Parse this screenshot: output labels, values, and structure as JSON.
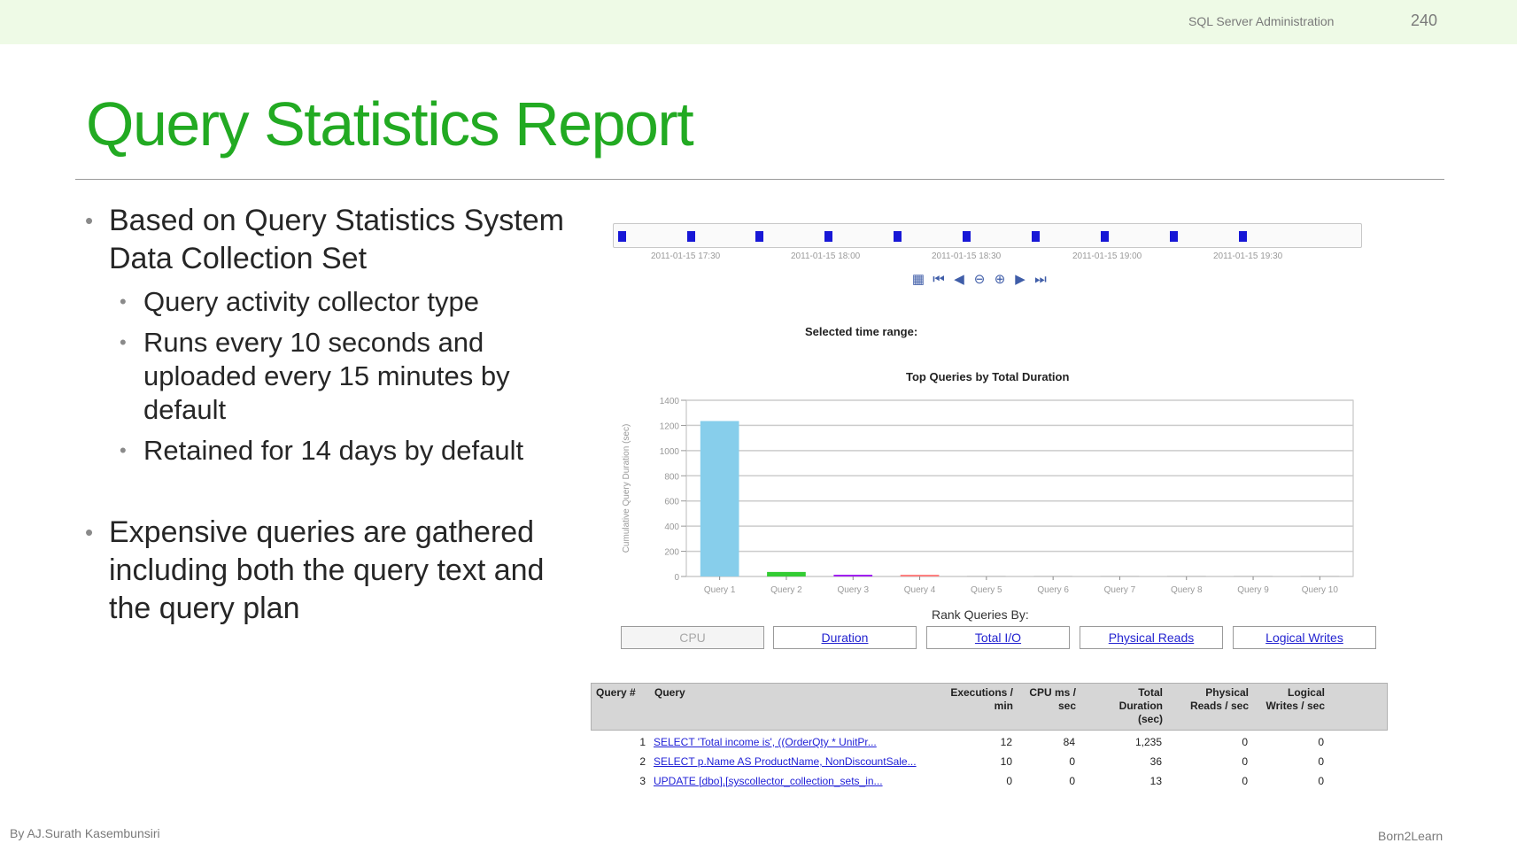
{
  "header": {
    "course": "SQL Server  Administration",
    "page_number": "240"
  },
  "slide": {
    "title": "Query Statistics Report",
    "bullets": [
      {
        "text": "Based on Query Statistics System Data Collection Set",
        "sub": [
          "Query activity collector type",
          "Runs every 10 seconds and uploaded every 15 minutes by default",
          "Retained for 14 days by default"
        ]
      },
      {
        "text": "Expensive queries are gathered including both the query text and the query plan"
      }
    ]
  },
  "report": {
    "timeline_labels": [
      "2011-01-15 17:30",
      "2011-01-15 18:00",
      "2011-01-15 18:30",
      "2011-01-15 19:00",
      "2011-01-15 19:30"
    ],
    "toolbar_icons": [
      "calendar-icon",
      "first-icon",
      "previous-icon",
      "zoom-out-icon",
      "zoom-in-icon",
      "next-icon",
      "last-icon"
    ],
    "selected_time_range_label": "Selected time range:",
    "rank_label": "Rank Queries By:",
    "rank_buttons": [
      "CPU",
      "Duration",
      "Total I/O",
      "Physical Reads",
      "Logical Writes"
    ],
    "table": {
      "headers": [
        "Query #",
        "Query",
        "Executions / min",
        "CPU ms / sec",
        "Total Duration (sec)",
        "Physical Reads / sec",
        "Logical Writes / sec"
      ],
      "rows": [
        {
          "num": "1",
          "query": "SELECT 'Total income is', ((OrderQty * UnitPr...",
          "exec": "12",
          "cpu": "84",
          "duration": "1,235",
          "reads": "0",
          "writes": "0"
        },
        {
          "num": "2",
          "query": "SELECT p.Name AS ProductName, NonDiscountSale...",
          "exec": "10",
          "cpu": "0",
          "duration": "36",
          "reads": "0",
          "writes": "0"
        },
        {
          "num": "3",
          "query": "UPDATE [dbo].[syscollector_collection_sets_in...",
          "exec": "0",
          "cpu": "0",
          "duration": "13",
          "reads": "0",
          "writes": "0"
        }
      ]
    }
  },
  "chart_data": {
    "type": "bar",
    "title": "Top Queries by Total Duration",
    "xlabel": "",
    "ylabel": "Cumulative Query Duration (sec)",
    "ylim": [
      0,
      1400
    ],
    "yticks": [
      0,
      200,
      400,
      600,
      800,
      1000,
      1200,
      1400
    ],
    "categories": [
      "Query 1",
      "Query 2",
      "Query 3",
      "Query 4",
      "Query 5",
      "Query 6",
      "Query 7",
      "Query 8",
      "Query 9",
      "Query 10"
    ],
    "values": [
      1235,
      36,
      13,
      4,
      0,
      0,
      0,
      0,
      0,
      0
    ],
    "colors": [
      "#87ceeb",
      "#33cc33",
      "#a020f0",
      "#ff8080",
      "#cccccc",
      "#cccccc",
      "#cccccc",
      "#cccccc",
      "#cccccc",
      "#cccccc"
    ],
    "grid": true
  },
  "footer": {
    "author": "By AJ.Surath Kasembunsiri",
    "brand": "Born2Learn"
  }
}
